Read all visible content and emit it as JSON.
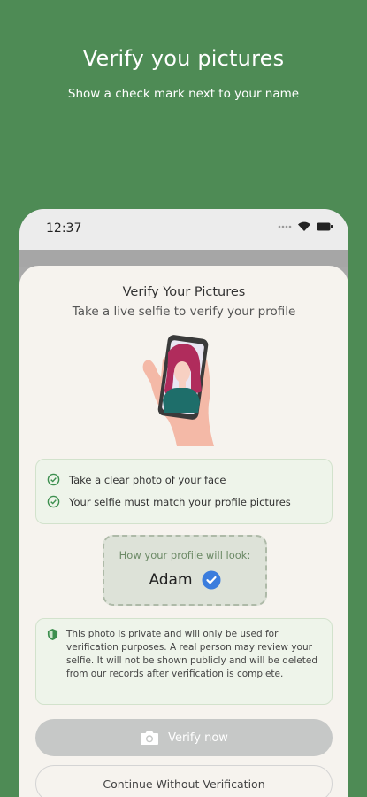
{
  "promo": {
    "title": "Verify you pictures",
    "subtitle": "Show a check mark next to your name"
  },
  "status_bar": {
    "time": "12:37",
    "icons": [
      "dots-icon",
      "wifi-icon",
      "battery-icon"
    ]
  },
  "sheet": {
    "title": "Verify Your Pictures",
    "subtitle": "Take a live selfie to verify your profile",
    "illustration": "selfie-phone-illustration",
    "tips": [
      {
        "icon": "check-circle-icon",
        "label": "Take a clear photo of your face"
      },
      {
        "icon": "check-circle-icon",
        "label": "Your selfie must match your profile pictures"
      }
    ],
    "preview": {
      "label": "How your profile will look:",
      "name": "Adam",
      "badge_icon": "verified-check-icon"
    },
    "privacy": {
      "icon": "shield-icon",
      "text": "This photo is private and will only be used for verification purposes. A real person may review your selfie. It will not be shown publicly and will be deleted from our records after verification is complete."
    },
    "verify_button": {
      "icon": "camera-icon",
      "label": "Verify now"
    },
    "continue_button": {
      "label": "Continue Without Verification"
    }
  },
  "colors": {
    "background": "#4e8b55",
    "accent": "#3d8f4f",
    "badge_blue": "#3b7ddd",
    "sheet": "#f6f3ee"
  }
}
